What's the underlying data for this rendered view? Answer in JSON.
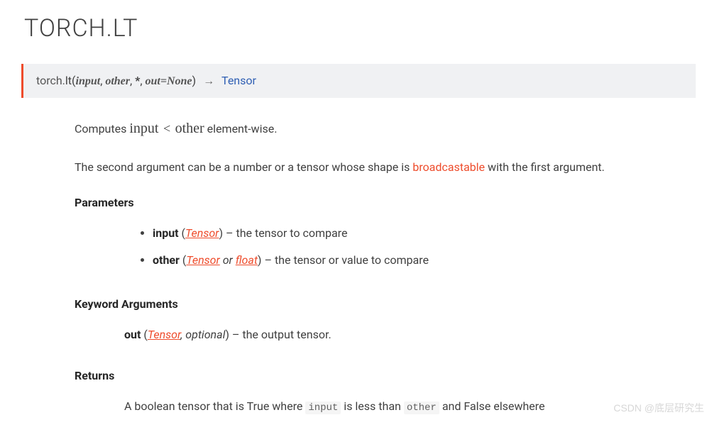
{
  "title": "TORCH.LT",
  "signature": {
    "module": "torch.",
    "func": "lt",
    "paren_open": "(",
    "param1": "input",
    "sep1": ", ",
    "param2": "other",
    "sep2": ", ",
    "star": "*",
    "sep3": ", ",
    "kw_name": "out",
    "kw_eq": "=",
    "kw_default": "None",
    "paren_close": ")",
    "arrow": " → ",
    "ret_type": "Tensor"
  },
  "desc1_a": "Computes ",
  "desc1_m1": "input",
  "desc1_op": " < ",
  "desc1_m2": "other",
  "desc1_b": " element-wise.",
  "desc2_a": "The second argument can be a number or a tensor whose shape is ",
  "desc2_link": "broadcastable",
  "desc2_b": " with the first argument.",
  "params_label": "Parameters",
  "params": [
    {
      "name": "input",
      "po": " (",
      "type": "Tensor",
      "pc": ") – ",
      "desc": "the tensor to compare"
    },
    {
      "name": "other",
      "po": " (",
      "type": "Tensor",
      "or": " or ",
      "type2": "float",
      "pc": ") – ",
      "desc": "the tensor or value to compare"
    }
  ],
  "kwargs_label": "Keyword Arguments",
  "kwarg": {
    "name": "out",
    "po": " (",
    "type": "Tensor",
    "comma": ", ",
    "opt": "optional",
    "pc": ") – ",
    "desc": "the output tensor."
  },
  "returns_label": "Returns",
  "returns": {
    "a": "A boolean tensor that is True where ",
    "c1": "input",
    "b": " is less than ",
    "c2": "other",
    "c": " and False elsewhere"
  },
  "watermark": "CSDN @底层研究生"
}
